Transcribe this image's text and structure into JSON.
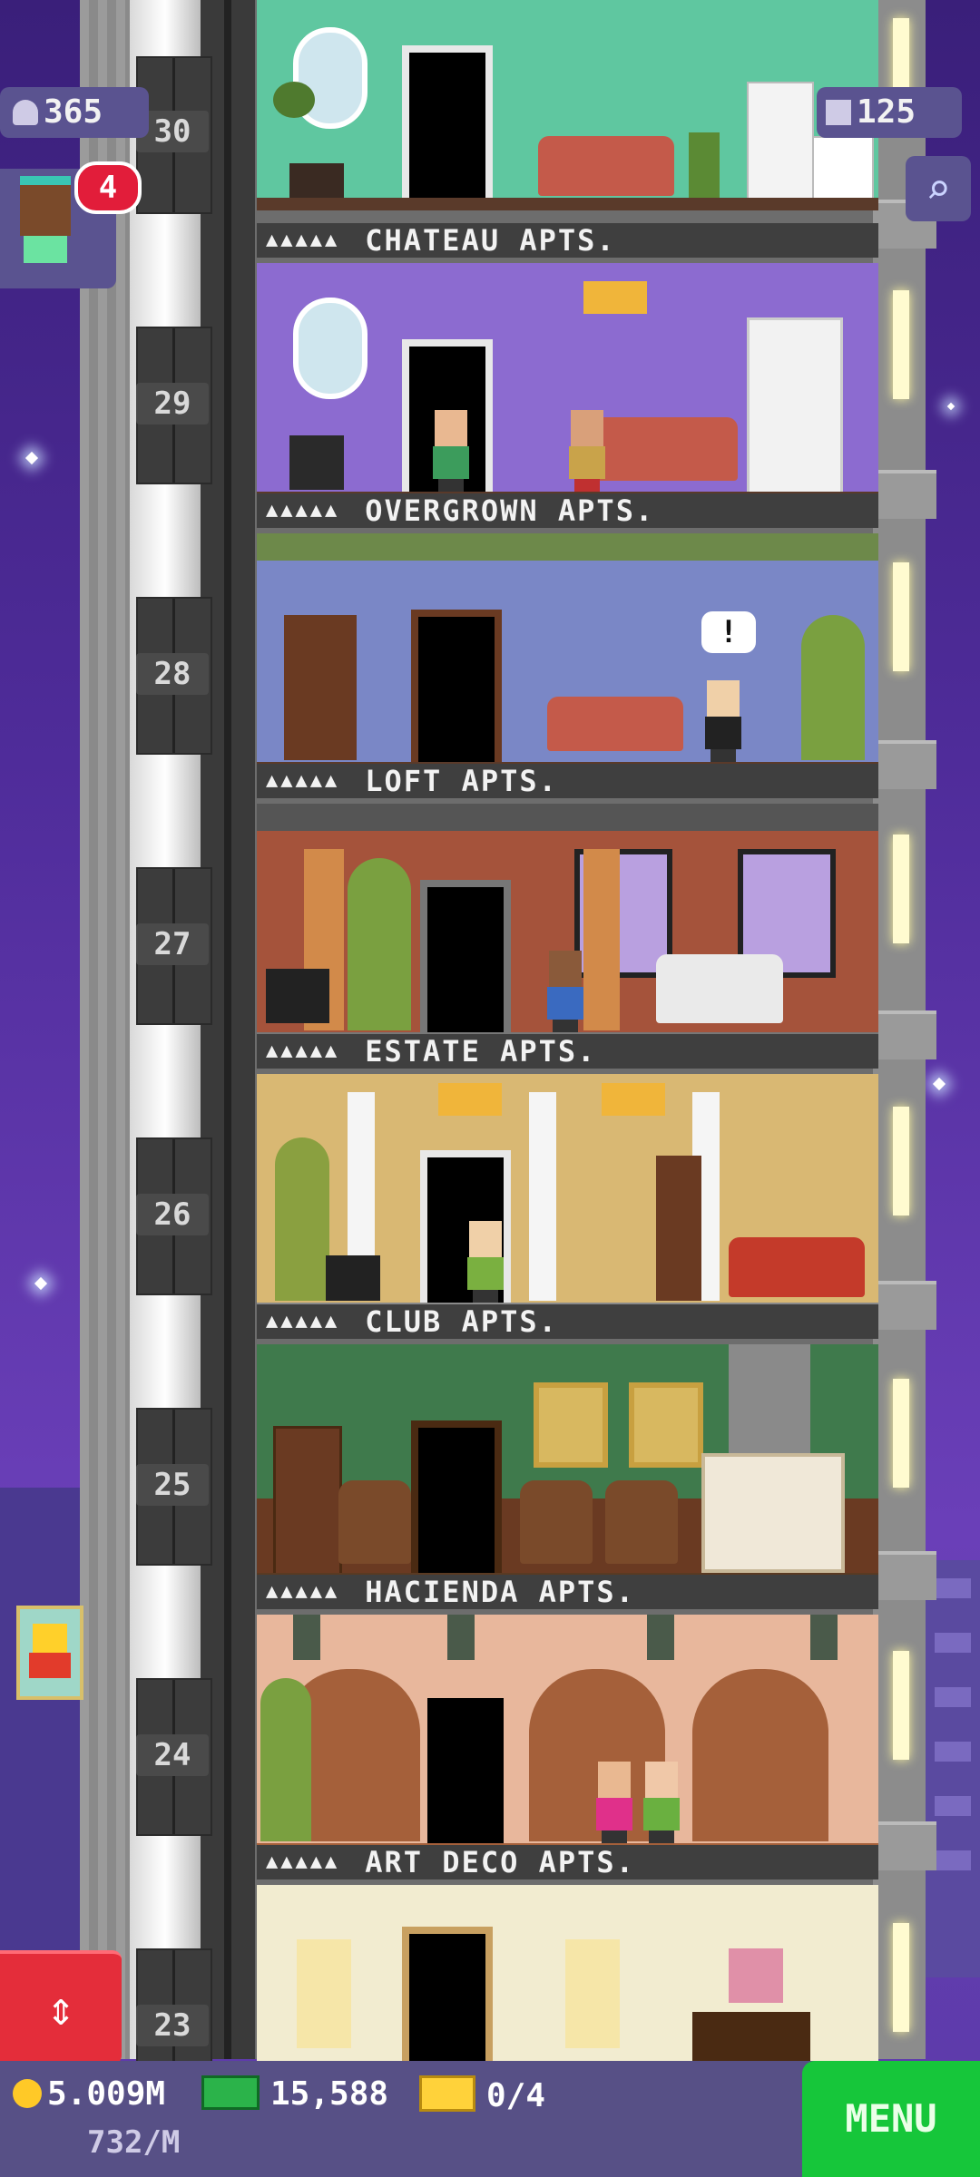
{
  "hud": {
    "population": "365",
    "bux_top": "125",
    "notification_count": "4"
  },
  "floors": [
    {
      "number": "30",
      "name": "CHATEAU APTS.",
      "wall_color": "#5fc7a0"
    },
    {
      "number": "29",
      "name": "OVERGROWN APTS.",
      "wall_color": "#8c6bd0"
    },
    {
      "number": "28",
      "name": "LOFT APTS.",
      "wall_color": "#7a87c6"
    },
    {
      "number": "27",
      "name": "ESTATE APTS.",
      "wall_color": "#a5533b"
    },
    {
      "number": "26",
      "name": "CLUB APTS.",
      "wall_color": "#d9b873"
    },
    {
      "number": "25",
      "name": "HACIENDA APTS.",
      "wall_color": "#3f7a4c"
    },
    {
      "number": "24",
      "name": "ART DECO APTS.",
      "wall_color": "#e8b79c"
    },
    {
      "number": "23",
      "name": "",
      "wall_color": "#f2ecd0"
    }
  ],
  "label_stars": "▲▲▲▲▲",
  "bottom": {
    "coins": "5.009M",
    "coin_rate": "732/M",
    "bux": "15,588",
    "tickets": "0/4",
    "menu_label": "MENU"
  },
  "thought_bubble": "!"
}
